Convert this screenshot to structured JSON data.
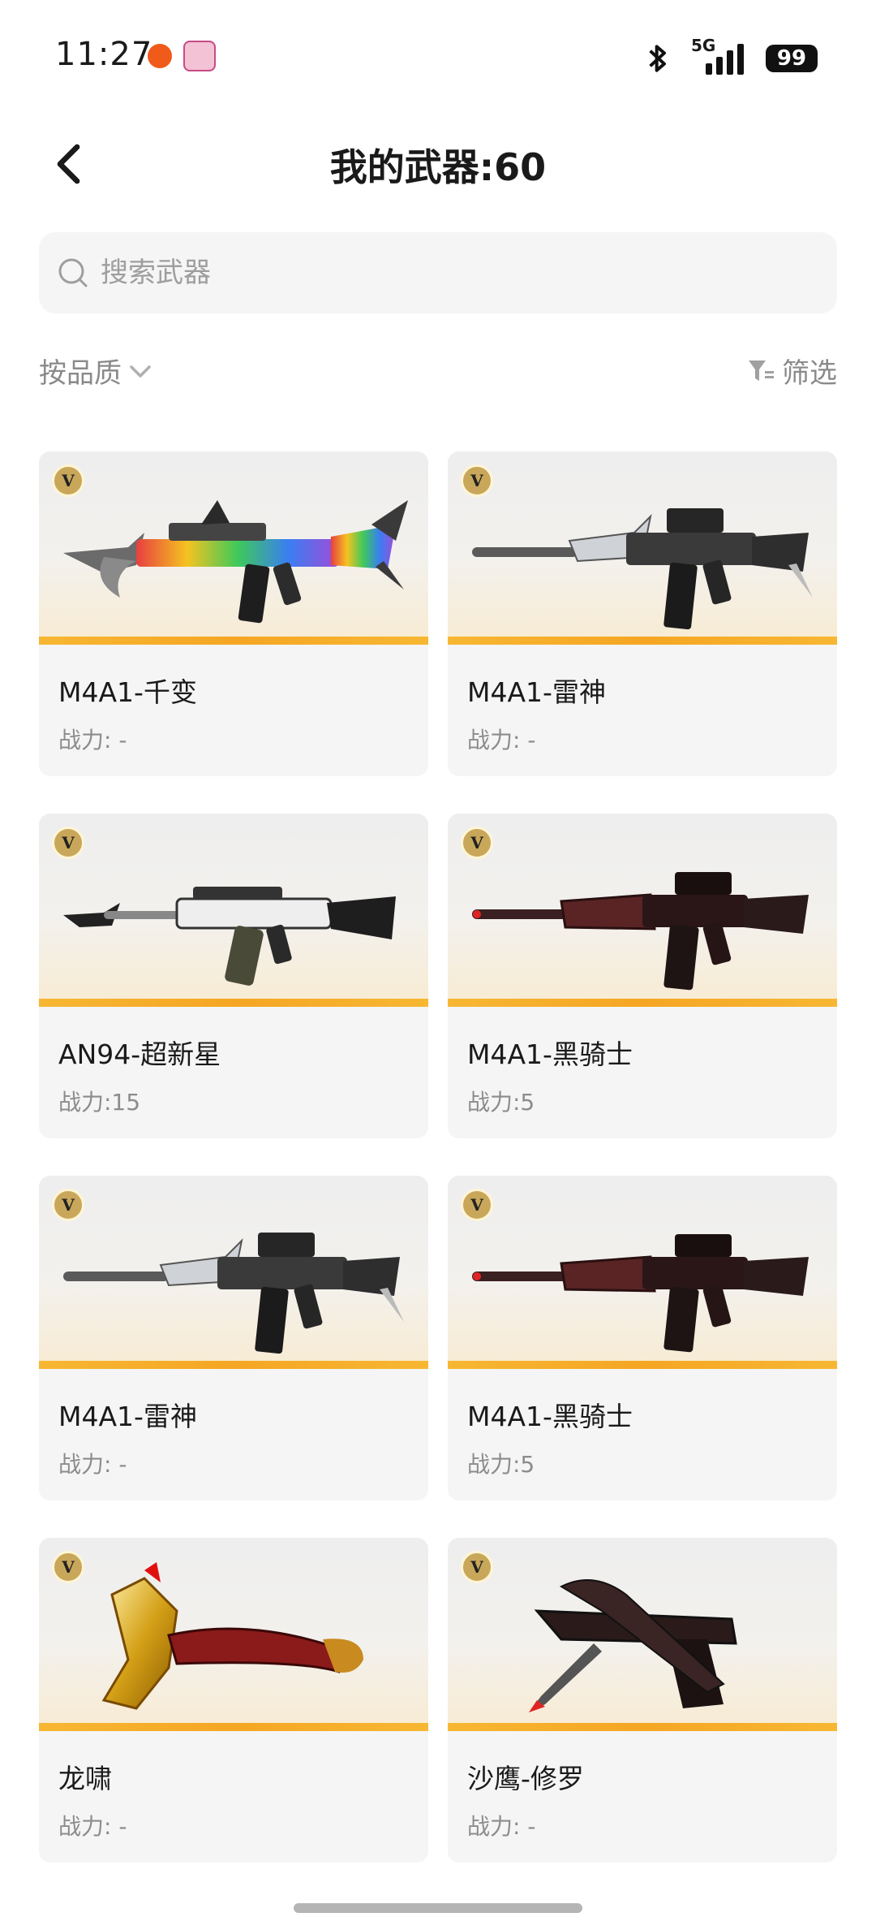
{
  "status_bar": {
    "time": "11:27",
    "network": "5G",
    "battery": "99"
  },
  "header": {
    "title": "我的武器:60"
  },
  "search": {
    "placeholder": "搜索武器"
  },
  "toolbar": {
    "sort_label": "按品质",
    "filter_label": "筛选"
  },
  "weapons": [
    {
      "name": "M4A1-千变",
      "power": "战力: -",
      "icon": "rifle-rainbow"
    },
    {
      "name": "M4A1-雷神",
      "power": "战力: -",
      "icon": "rifle-silver"
    },
    {
      "name": "AN94-超新星",
      "power": "战力:15",
      "icon": "rifle-white"
    },
    {
      "name": "M4A1-黑骑士",
      "power": "战力:5",
      "icon": "rifle-dark-red"
    },
    {
      "name": "M4A1-雷神",
      "power": "战力: -",
      "icon": "rifle-silver"
    },
    {
      "name": "M4A1-黑骑士",
      "power": "战力:5",
      "icon": "rifle-dark-red"
    },
    {
      "name": "龙啸",
      "power": "战力: -",
      "icon": "axe-gold-dragon"
    },
    {
      "name": "沙鹰-修罗",
      "power": "战力: -",
      "icon": "pistol-dark-blade"
    }
  ],
  "colors": {
    "accent_bar": "#f5a623",
    "card_bg": "#f5f5f5",
    "muted_text": "#8c8c8c"
  }
}
